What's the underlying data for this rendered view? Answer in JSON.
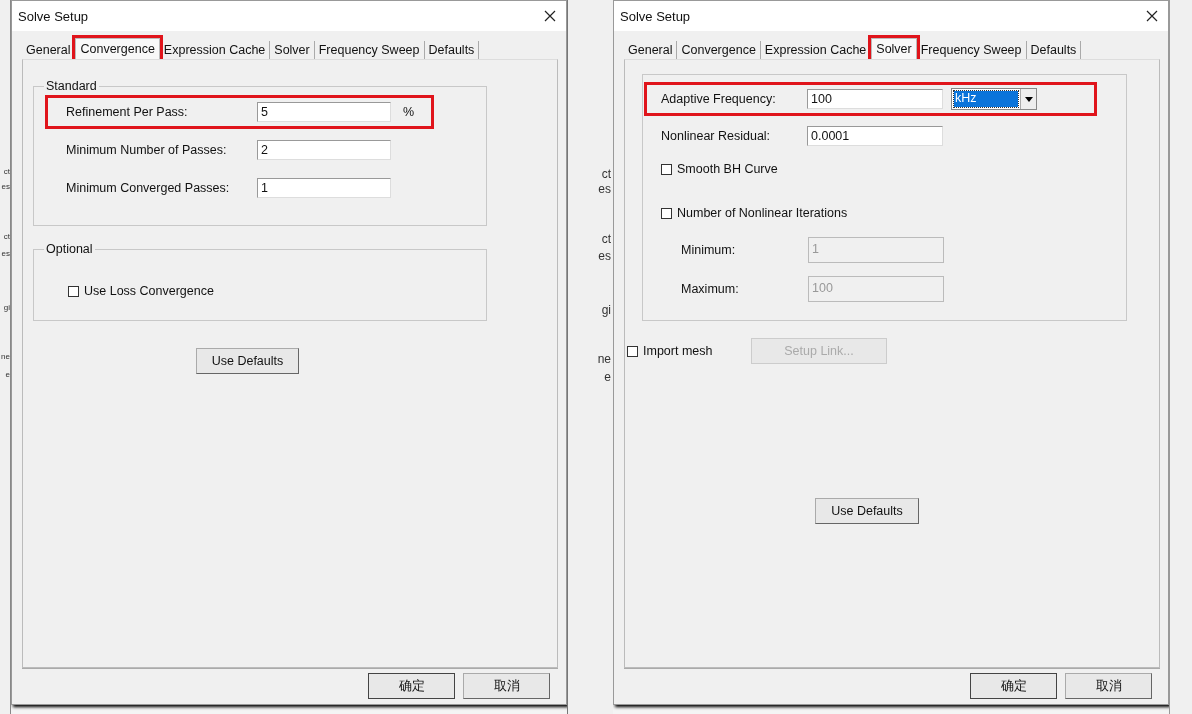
{
  "background": {
    "left_edge_fragments": [
      "ct",
      "es",
      "ct",
      "es",
      "gi",
      "ne",
      "e"
    ],
    "middle_edge_fragments": [
      "ct",
      "es",
      "ct",
      "es",
      "gi",
      "ne",
      "e"
    ]
  },
  "dialogs": [
    {
      "kind": "convergence",
      "title": "Solve Setup",
      "tabs": [
        {
          "label": "General",
          "selected": false,
          "highlighted": false
        },
        {
          "label": "Convergence",
          "selected": true,
          "highlighted": true
        },
        {
          "label": "Expression Cache",
          "selected": false,
          "highlighted": false
        },
        {
          "label": "Solver",
          "selected": false,
          "highlighted": false
        },
        {
          "label": "Frequency Sweep",
          "selected": false,
          "highlighted": false
        },
        {
          "label": "Defaults",
          "selected": false,
          "highlighted": false
        }
      ],
      "standard": {
        "title": "Standard",
        "rows": [
          {
            "label": "Refinement Per Pass:",
            "value": "5",
            "unit": "%",
            "highlighted": true
          },
          {
            "label": "Minimum Number of Passes:",
            "value": "2",
            "highlighted": false
          },
          {
            "label": "Minimum Converged Passes:",
            "value": "1",
            "highlighted": false
          }
        ]
      },
      "optional": {
        "title": "Optional",
        "checkbox": {
          "label": "Use Loss Convergence",
          "checked": false
        }
      },
      "defaults_button": "Use Defaults",
      "buttons": [
        "确定",
        "取消"
      ]
    },
    {
      "kind": "solver",
      "title": "Solve Setup",
      "tabs": [
        {
          "label": "General",
          "selected": false,
          "highlighted": false
        },
        {
          "label": "Convergence",
          "selected": false,
          "highlighted": false
        },
        {
          "label": "Expression Cache",
          "selected": false,
          "highlighted": false
        },
        {
          "label": "Solver",
          "selected": true,
          "highlighted": true
        },
        {
          "label": "Frequency Sweep",
          "selected": false,
          "highlighted": false
        },
        {
          "label": "Defaults",
          "selected": false,
          "highlighted": false
        }
      ],
      "adaptive": {
        "label": "Adaptive Frequency:",
        "value": "100",
        "unit": "kHz",
        "highlighted": true
      },
      "residual": {
        "label": "Nonlinear Residual:",
        "value": "0.0001"
      },
      "smooth": {
        "label": "Smooth BH Curve",
        "checked": false
      },
      "iterations": {
        "label": "Number of Nonlinear Iterations",
        "checked": false,
        "fields": [
          {
            "label": "Minimum:",
            "value": "1",
            "disabled": true
          },
          {
            "label": "Maximum:",
            "value": "100",
            "disabled": true
          }
        ]
      },
      "import_mesh": {
        "label": "Import mesh",
        "checked": false
      },
      "setup_link": {
        "label": "Setup Link...",
        "disabled": true
      },
      "defaults_button": "Use Defaults",
      "buttons": [
        "确定",
        "取消"
      ]
    }
  ]
}
